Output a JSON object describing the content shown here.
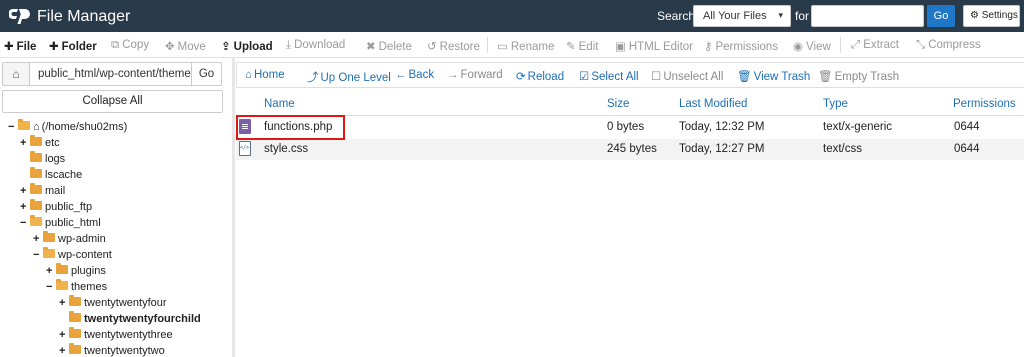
{
  "header": {
    "app_title": "File Manager",
    "search_label": "Search",
    "search_scope": "All Your Files",
    "for_label": "for",
    "search_value": "",
    "go_label": "Go",
    "settings_label": "Settings",
    "colors": {
      "bar": "#293a4a",
      "go": "#1f77c8"
    }
  },
  "toolbar": {
    "file": "File",
    "folder": "Folder",
    "copy": "Copy",
    "move": "Move",
    "upload": "Upload",
    "download": "Download",
    "delete": "Delete",
    "restore": "Restore",
    "rename": "Rename",
    "edit": "Edit",
    "html_editor": "HTML Editor",
    "permissions": "Permissions",
    "view": "View",
    "extract": "Extract",
    "compress": "Compress"
  },
  "left": {
    "path_value": "public_html/wp-content/themes",
    "go_label": "Go",
    "collapse_all": "Collapse All",
    "tree": [
      {
        "label": "(/home/shu02ms)",
        "toggle": "−"
      },
      {
        "label": "etc",
        "toggle": "+"
      },
      {
        "label": "logs",
        "toggle": ""
      },
      {
        "label": "lscache",
        "toggle": ""
      },
      {
        "label": "mail",
        "toggle": "+"
      },
      {
        "label": "public_ftp",
        "toggle": "+"
      },
      {
        "label": "public_html",
        "toggle": "−"
      },
      {
        "label": "wp-admin",
        "toggle": "+"
      },
      {
        "label": "wp-content",
        "toggle": "−"
      },
      {
        "label": "plugins",
        "toggle": "+"
      },
      {
        "label": "themes",
        "toggle": "−"
      },
      {
        "label": "twentytwentyfour",
        "toggle": "+"
      },
      {
        "label": "twentytwentyfourchild",
        "toggle": ""
      },
      {
        "label": "twentytwentythree",
        "toggle": "+"
      },
      {
        "label": "twentytwentytwo",
        "toggle": "+"
      }
    ]
  },
  "nav": {
    "home": "Home",
    "up_one_level": "Up One Level",
    "back": "Back",
    "forward": "Forward",
    "reload": "Reload",
    "select_all": "Select All",
    "unselect_all": "Unselect All",
    "view_trash": "View Trash",
    "empty_trash": "Empty Trash"
  },
  "table": {
    "columns": [
      "Name",
      "Size",
      "Last Modified",
      "Type",
      "Permissions"
    ],
    "rows": [
      {
        "name": "functions.php",
        "size": "0 bytes",
        "modified": "Today, 12:32 PM",
        "type": "text/x-generic",
        "perms": "0644",
        "icon": "php-file-icon"
      },
      {
        "name": "style.css",
        "size": "245 bytes",
        "modified": "Today, 12:27 PM",
        "type": "text/css",
        "perms": "0644",
        "icon": "css-file-icon"
      }
    ],
    "highlight_color": "#e01717"
  }
}
